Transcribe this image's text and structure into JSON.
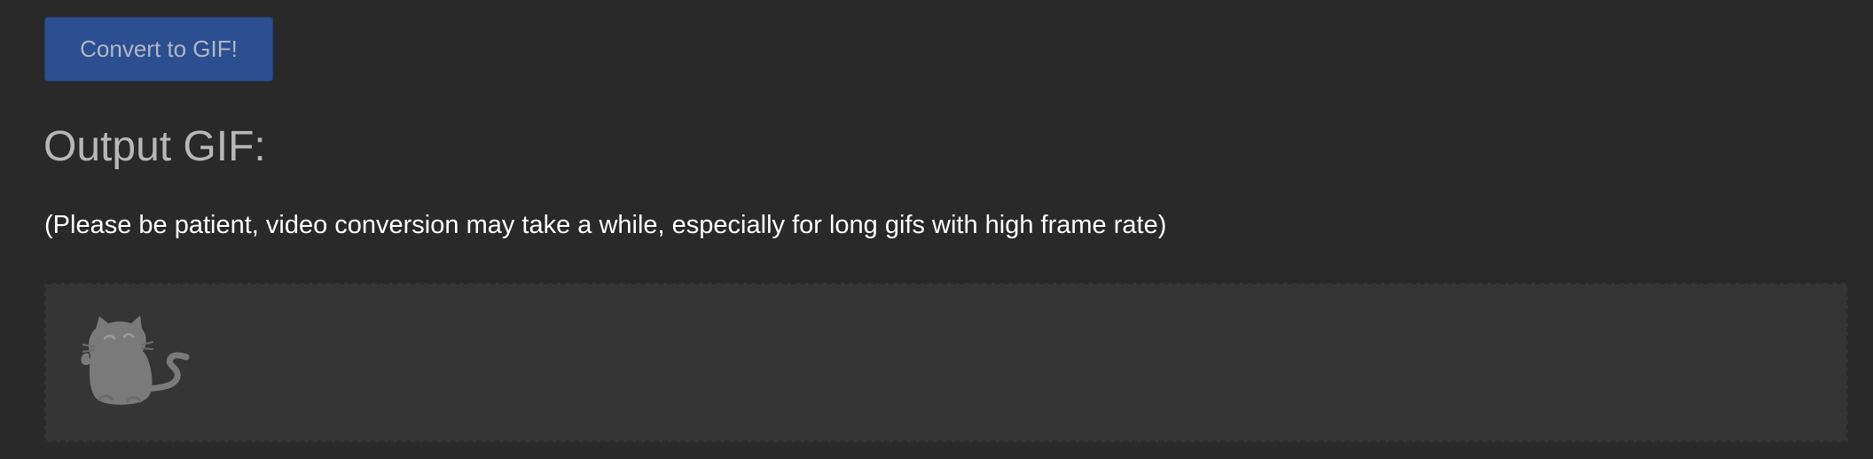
{
  "actions": {
    "convert_label": "Convert to GIF!"
  },
  "output": {
    "heading": "Output GIF:",
    "note": "(Please be patient, video conversion may take a while, especially for long gifs with high frame rate)",
    "placeholder_icon": "cat-icon"
  },
  "colors": {
    "page_background": "#292929",
    "button_background": "#2b4f8f",
    "panel_background": "#353535",
    "cat_placeholder": "#7a7a7a"
  }
}
